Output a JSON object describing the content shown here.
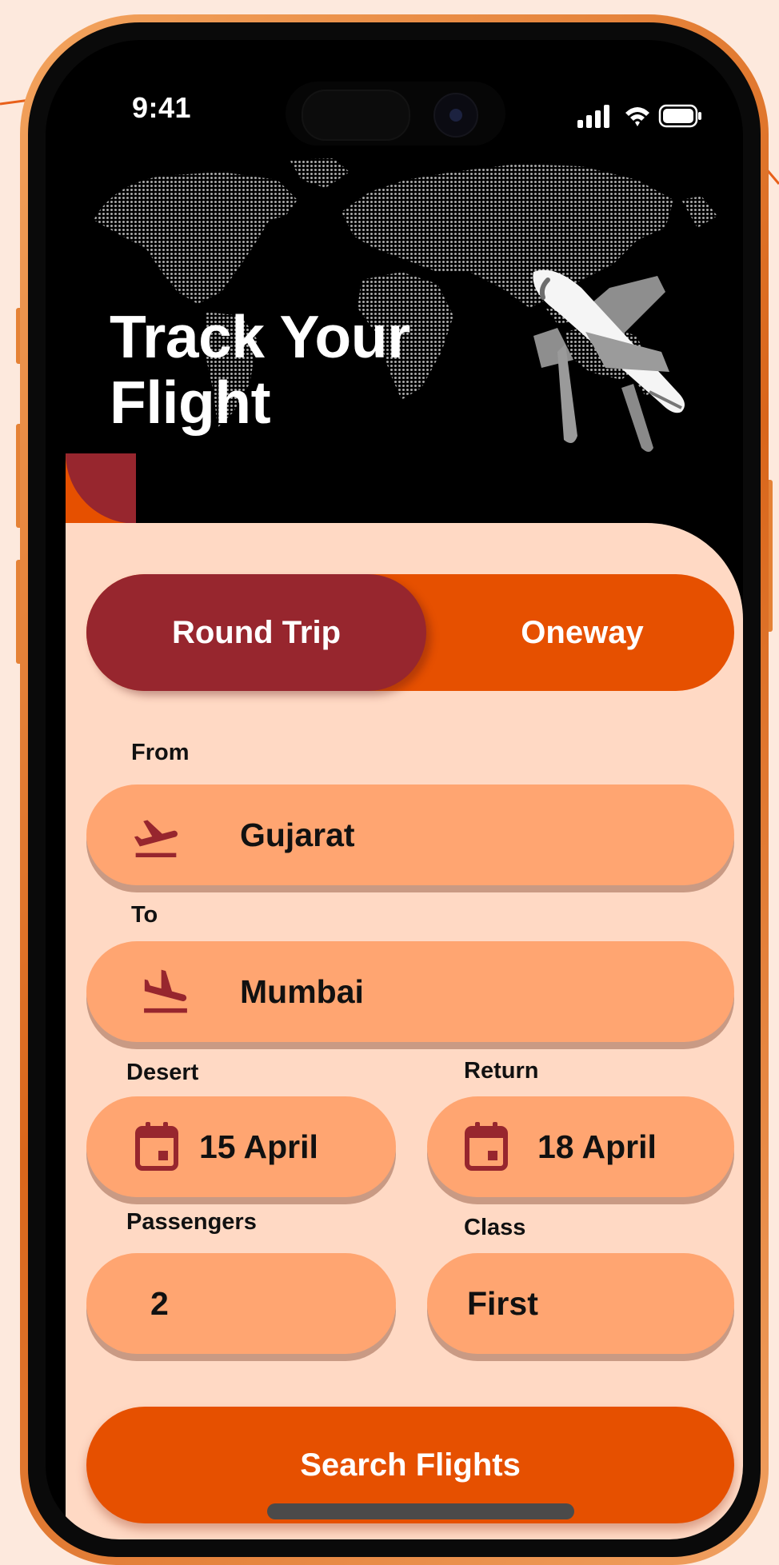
{
  "status_bar": {
    "time": "9:41"
  },
  "hero": {
    "title": "Track Your\nFlight"
  },
  "trip_type": {
    "options": [
      "Round Trip",
      "Oneway"
    ],
    "selected": "Round Trip"
  },
  "form": {
    "from": {
      "label": "From",
      "value": "Gujarat",
      "icon": "airplane-takeoff-icon"
    },
    "to": {
      "label": "To",
      "value": "Mumbai",
      "icon": "airplane-landing-icon"
    },
    "depart": {
      "label": "Desert",
      "value": "15 April",
      "icon": "calendar-icon"
    },
    "return": {
      "label": "Return",
      "value": "18 April",
      "icon": "calendar-icon"
    },
    "passengers": {
      "label": "Passengers",
      "value": "2"
    },
    "class": {
      "label": "Class",
      "value": "First"
    }
  },
  "search_button": {
    "label": "Search Flights"
  },
  "colors": {
    "accent_orange": "#e65000",
    "accent_maroon": "#97262e",
    "panel_bg": "#ffd9c4",
    "field_bg": "#ffa571",
    "phone_frame": "#e0782c"
  }
}
